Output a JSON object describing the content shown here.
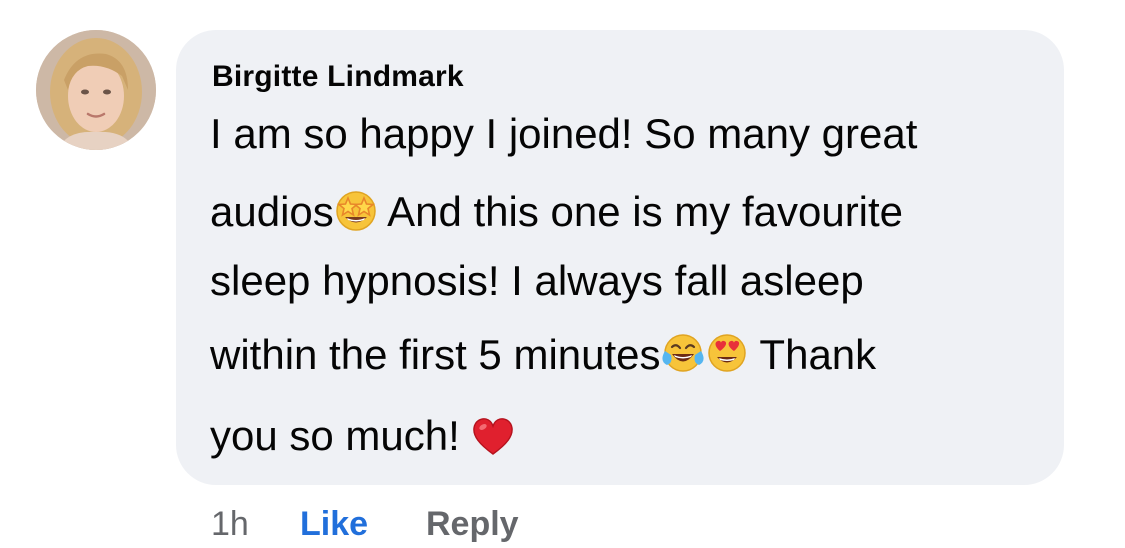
{
  "comment": {
    "author": "Birgitte Lindmark",
    "avatar_icon": "profile-photo",
    "lines": [
      {
        "segments": [
          "I am so happy I joined! So many great"
        ]
      },
      {
        "segments": [
          "audios",
          "star-struck-emoji",
          " And this one is my favourite"
        ]
      },
      {
        "segments": [
          "sleep hypnosis! I always fall asleep"
        ]
      },
      {
        "segments": [
          "within the first 5 minutes",
          "tears-of-joy-emoji",
          "heart-eyes-emoji",
          " Thank"
        ]
      },
      {
        "segments": [
          "you so much! ",
          "red-heart-emoji"
        ]
      }
    ],
    "line1": "I am so happy I joined! So many great",
    "line2a": "audios",
    "line2b": " And this one is my favourite",
    "line3": "sleep hypnosis! I always fall asleep",
    "line4a": "within the first 5 minutes",
    "line4b": " Thank",
    "line5a": "you so much! "
  },
  "actions": {
    "time": "1h",
    "like": "Like",
    "reply": "Reply"
  },
  "colors": {
    "bubble_bg": "#eff1f5",
    "like_blue": "#216fdb",
    "secondary_gray": "#65676b",
    "text": "#050505"
  }
}
